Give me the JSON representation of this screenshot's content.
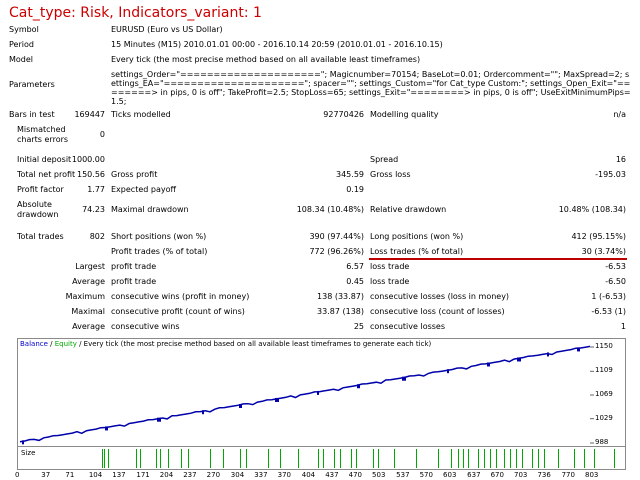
{
  "title": "Cat_type: Risk, Indicators_variant: 1",
  "rows": {
    "symbol_label": "Symbol",
    "symbol_value": "EURUSD (Euro vs US Dollar)",
    "period_label": "Period",
    "period_value": "15 Minutes (M15) 2010.01.01 00:00 - 2016.10.14 20:59 (2010.01.01 - 2016.10.15)",
    "model_label": "Model",
    "model_value": "Every tick (the most precise method based on all available least timeframes)",
    "params_label": "Parameters",
    "params_value": "settings_Order=\"=====================\"; Magicnumber=70154; BaseLot=0.01; Ordercomment=\"\"; MaxSpread=2; settings_EA=\"=====================\"; spacer=\"\"; settings_Custom=\"for Cat_type Custom:\"; settings_Open_Exit=\"========> in pips, 0 is off\"; TakeProfit=2.5; StopLoss=65; settings_Exit=\"========> in pips, 0 is off\"; UseExitMinimumPips=1.5;",
    "bars_label": "Bars in test",
    "bars_value": "169447",
    "ticks_label": "Ticks modelled",
    "ticks_value": "92770426",
    "quality_label": "Modelling quality",
    "quality_value": "n/a",
    "mismatch_label_1": "Mismatched",
    "mismatch_label_2": "charts errors",
    "mismatch_value": "0",
    "deposit_label": "Initial deposit",
    "deposit_value": "1000.00",
    "spread_label": "Spread",
    "spread_value": "16",
    "netprofit_label": "Total net profit",
    "netprofit_value": "150.56",
    "grossprofit_label": "Gross profit",
    "grossprofit_value": "345.59",
    "grossloss_label": "Gross loss",
    "grossloss_value": "-195.03",
    "pf_label": "Profit factor",
    "pf_value": "1.77",
    "payoff_label": "Expected payoff",
    "payoff_value": "0.19",
    "absdd_label_1": "Absolute",
    "absdd_label_2": "drawdown",
    "absdd_value": "74.23",
    "maxdd_label": "Maximal drawdown",
    "maxdd_value": "108.34 (10.48%)",
    "reldd_label": "Relative drawdown",
    "reldd_value": "10.48% (108.34)",
    "trades_label": "Total trades",
    "trades_value": "802",
    "short_label": "Short positions (won %)",
    "short_value": "390 (97.44%)",
    "long_label": "Long positions (won %)",
    "long_value": "412 (95.15%)",
    "ptrades_label": "Profit trades (% of total)",
    "ptrades_value": "772 (96.26%)",
    "ltrades_label": "Loss trades (% of total)",
    "ltrades_value": "30 (3.74%)",
    "largest_label": "Largest",
    "largest_pt_label": "profit trade",
    "largest_pt_value": "6.57",
    "largest_lt_label": "loss trade",
    "largest_lt_value": "-6.53",
    "average_label": "Average",
    "average_pt_label": "profit trade",
    "average_pt_value": "0.45",
    "average_lt_label": "loss trade",
    "average_lt_value": "-6.50",
    "maximum_label": "Maximum",
    "max_cw_label": "consecutive wins (profit in money)",
    "max_cw_value": "138 (33.87)",
    "max_cl_label": "consecutive losses (loss in money)",
    "max_cl_value": "1 (-6.53)",
    "maximal_label": "Maximal",
    "maximal_cp_label": "consecutive profit (count of wins)",
    "maximal_cp_value": "33.87 (138)",
    "maximal_cl_label": "consecutive loss (count of losses)",
    "maximal_cl_value": "-6.53 (1)",
    "avg2_label": "Average",
    "avg_cw_label": "consecutive wins",
    "avg_cw_value": "25",
    "avg_cl_label": "consecutive losses",
    "avg_cl_value": "1"
  },
  "chart": {
    "legend_balance": "Balance",
    "legend_sep": " / ",
    "legend_equity": "Equity",
    "legend_rest": " / Every tick (the most precise method based on all available least timeframes to generate each tick)",
    "size_label": "Size",
    "balance_color": "#0000aa",
    "equity_color": "#00aa00"
  },
  "chart_data": {
    "type": "line",
    "title": "",
    "y_ticks": [
      "1150",
      "1109",
      "1069",
      "1029",
      "988"
    ],
    "x_ticks": [
      "0",
      "37",
      "71",
      "104",
      "137",
      "171",
      "204",
      "237",
      "270",
      "304",
      "337",
      "370",
      "404",
      "437",
      "470",
      "503",
      "537",
      "570",
      "603",
      "637",
      "670",
      "703",
      "736",
      "770",
      "803"
    ],
    "ylim": [
      988,
      1150
    ],
    "xlim": [
      0,
      803
    ],
    "series": [
      {
        "x": [
          0,
          803
        ],
        "y": [
          990,
          1151
        ]
      }
    ]
  }
}
